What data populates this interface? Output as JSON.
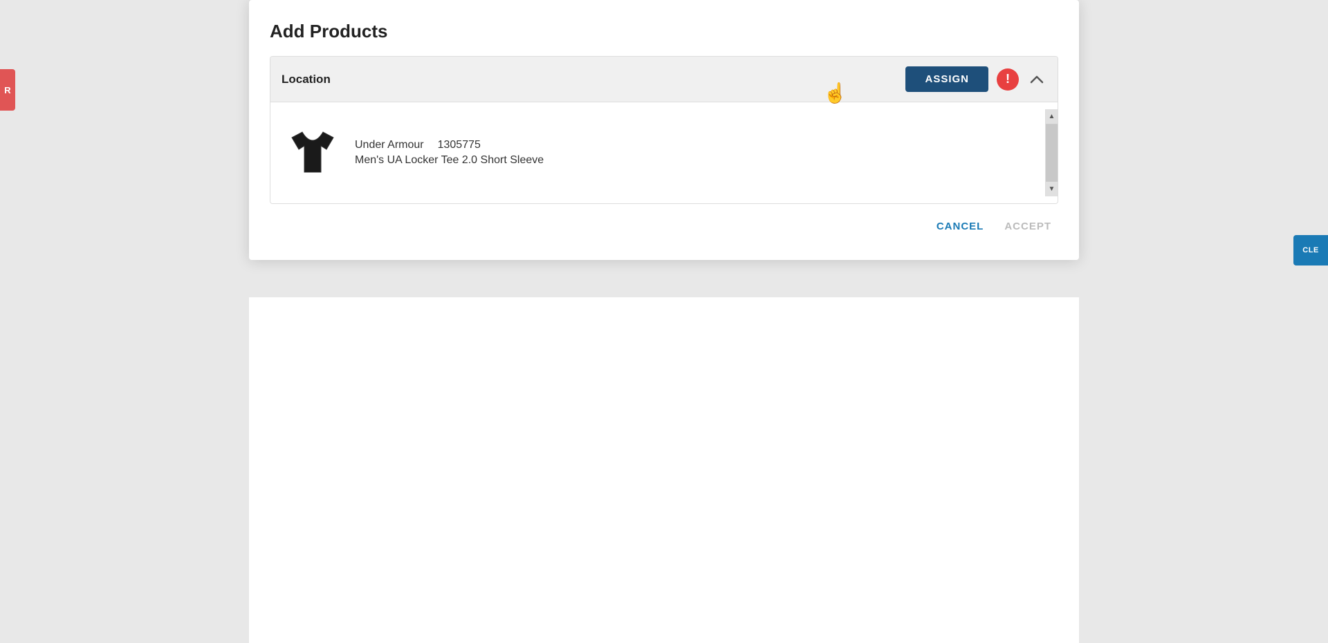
{
  "page": {
    "background_color": "#e8e8e8"
  },
  "dialog": {
    "title": "Add Products",
    "location_label": "Location",
    "assign_button_label": "ASSIGN",
    "cancel_button_label": "CANCEL",
    "accept_button_label": "ACCEPT"
  },
  "product": {
    "brand": "Under Armour",
    "sku": "1305775",
    "name": "Men's UA Locker Tee 2.0 Short Sleeve"
  },
  "edge_buttons": {
    "left_label": "R",
    "right_label": "CLE"
  }
}
